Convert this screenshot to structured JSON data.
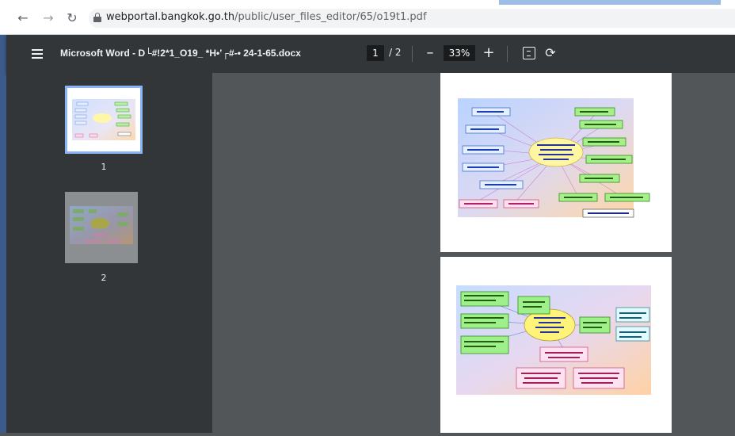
{
  "browser": {
    "back_icon": "arrow-left-icon",
    "forward_icon": "arrow-right-icon",
    "reload_icon": "reload-icon",
    "url_host": "webportal.bangkok.go.th",
    "url_path": "/public/user_files_editor/65/o19t1.pdf"
  },
  "toolbar": {
    "title": "Microsoft Word - D└#!2*1_O19_ *H•ʽ┌#-• 24-1-65.docx",
    "current_page": "1",
    "page_separator": "/ 2",
    "zoom_out": "–",
    "zoom": "33%",
    "zoom_in": "+"
  },
  "sidebar": {
    "thumbnails": [
      {
        "label": "1",
        "selected": true
      },
      {
        "label": "2",
        "selected": false
      }
    ]
  },
  "colors": {
    "toolbar_bg": "#323639",
    "viewer_bg": "#525659",
    "selected_thumb_border": "#8ab4f8"
  }
}
